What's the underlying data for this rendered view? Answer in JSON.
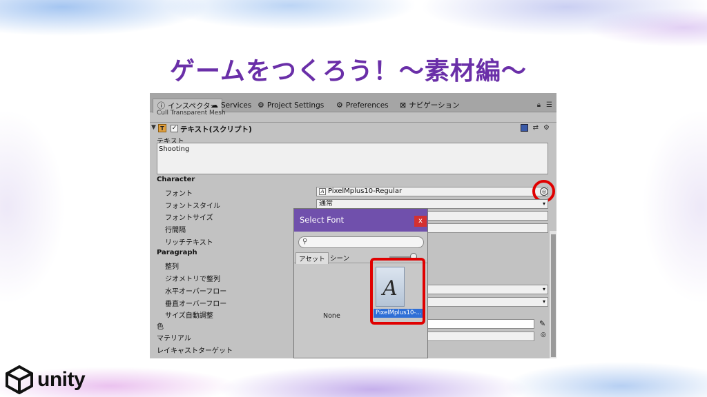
{
  "slide": {
    "title": "ゲームをつくろう！～素材編～",
    "logo_text": "unity"
  },
  "editor": {
    "tabs": [
      {
        "label": "インスペクター",
        "icon": "info-icon"
      },
      {
        "label": "Services",
        "icon": "cloud-icon"
      },
      {
        "label": "Project Settings",
        "icon": "gear-icon"
      },
      {
        "label": "Preferences",
        "icon": "gear-icon"
      },
      {
        "label": "ナビゲーション",
        "icon": "nav-icon"
      }
    ],
    "cut_row": "Cull Transparent Mesh",
    "component": {
      "title": "テキスト(スクリプト)",
      "enabled": true
    },
    "labels": {
      "text": "テキスト",
      "character": "Character",
      "font": "フォント",
      "font_style": "フォントスタイル",
      "font_size": "フォントサイズ",
      "line_spacing": "行間隔",
      "rich_text": "リッチテキスト",
      "paragraph": "Paragraph",
      "alignment": "整列",
      "align_by_geometry": "ジオメトリで整列",
      "horizontal_overflow": "水平オーバーフロー",
      "vertical_overflow": "垂直オーバーフロー",
      "best_fit": "サイズ自動調整",
      "color": "色",
      "material": "マテリアル",
      "raycast_target": "レイキャストターゲット"
    },
    "values": {
      "text": "Shooting",
      "font": "PixelMplus10-Regular",
      "font_style": "通常"
    },
    "highlight_color": "#e00000"
  },
  "dialog": {
    "title": "Select Font",
    "close": "x",
    "tabs": [
      "アセット",
      "シーン"
    ],
    "none_label": "None",
    "selected_font": "PixelMplus10-...",
    "preview_glyph": "A",
    "title_bar_color": "#7050ac"
  }
}
